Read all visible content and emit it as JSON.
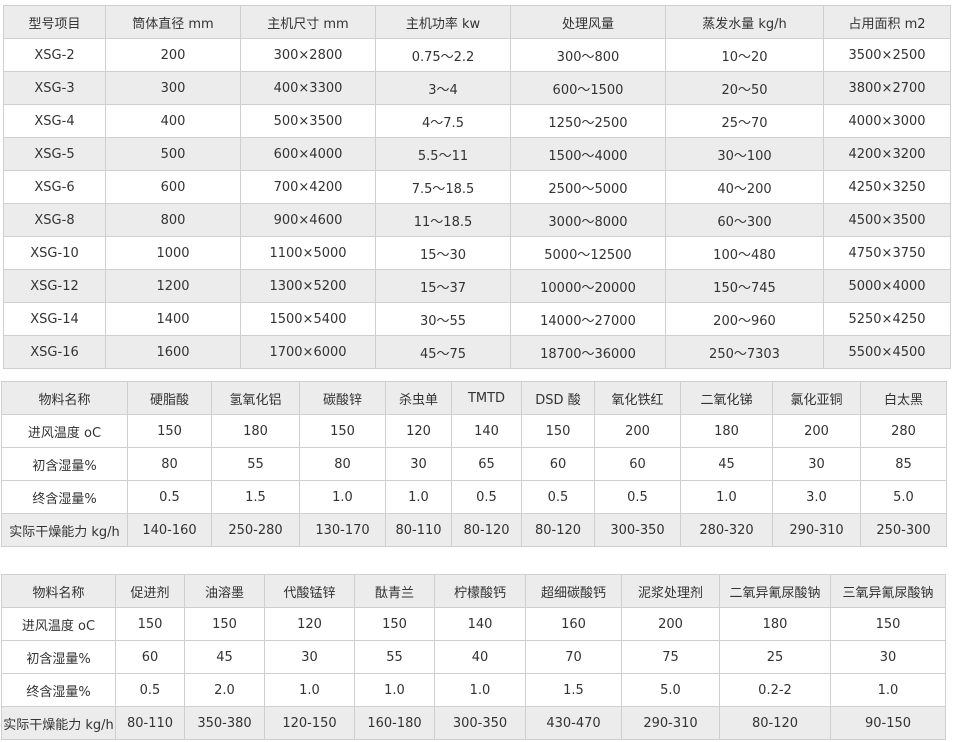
{
  "table1": {
    "header": [
      "型号项目",
      "筒体直径 mm",
      "主机尺寸 mm",
      "主机功率 kw",
      "处理风量",
      "蒸发水量 kg/h",
      "占用面积 m2"
    ],
    "rows": [
      [
        "XSG-2",
        "200",
        "300×2800",
        "0.75～2.2",
        "300～800",
        "10～20",
        "3500×2500"
      ],
      [
        "XSG-3",
        "300",
        "400×3300",
        "3～4",
        "600～1500",
        "20～50",
        "3800×2700"
      ],
      [
        "XSG-4",
        "400",
        "500×3500",
        "4～7.5",
        "1250～2500",
        "25～70",
        "4000×3000"
      ],
      [
        "XSG-5",
        "500",
        "600×4000",
        "5.5～11",
        "1500～4000",
        "30～100",
        "4200×3200"
      ],
      [
        "XSG-6",
        "600",
        "700×4200",
        "7.5～18.5",
        "2500～5000",
        "40～200",
        "4250×3250"
      ],
      [
        "XSG-8",
        "800",
        "900×4600",
        "11～18.5",
        "3000～8000",
        "60～300",
        "4500×3500"
      ],
      [
        "XSG-10",
        "1000",
        "1100×5000",
        "15～30",
        "5000～12500",
        "100～480",
        "4750×3750"
      ],
      [
        "XSG-12",
        "1200",
        "1300×5200",
        "15～37",
        "10000～20000",
        "150～745",
        "5000×4000"
      ],
      [
        "XSG-14",
        "1400",
        "1500×5400",
        "30～55",
        "14000～27000",
        "200～960",
        "5250×4250"
      ],
      [
        "XSG-16",
        "1600",
        "1700×6000",
        "45～75",
        "18700～36000",
        "250～7303",
        "5500×4500"
      ]
    ]
  },
  "table2": {
    "rows": [
      [
        "物料名称",
        "硬脂酸",
        "氢氧化铝",
        "碳酸锌",
        "杀虫单",
        "TMTD",
        "DSD 酸",
        "氧化铁红",
        "二氧化锑",
        "氯化亚铜",
        "白太黑"
      ],
      [
        "进风温度 oC",
        "150",
        "180",
        "150",
        "120",
        "140",
        "150",
        "200",
        "180",
        "200",
        "280"
      ],
      [
        "初含湿量%",
        "80",
        "55",
        "80",
        "30",
        "65",
        "60",
        "60",
        "45",
        "30",
        "85"
      ],
      [
        "终含湿量%",
        "0.5",
        "1.5",
        "1.0",
        "1.0",
        "0.5",
        "0.5",
        "0.5",
        "1.0",
        "3.0",
        "5.0"
      ],
      [
        "实际干燥能力 kg/h",
        "140-160",
        "250-280",
        "130-170",
        "80-110",
        "80-120",
        "80-120",
        "300-350",
        "280-320",
        "290-310",
        "250-300"
      ]
    ]
  },
  "table3": {
    "rows": [
      [
        "物料名称",
        "促进剂",
        "油溶墨",
        "代酸锰锌",
        "酞青兰",
        "柠檬酸钙",
        "超细碳酸钙",
        "泥浆处理剂",
        "二氧异氰尿酸钠",
        "三氧异氰尿酸钠"
      ],
      [
        "进风温度 oC",
        "150",
        "150",
        "120",
        "150",
        "140",
        "160",
        "200",
        "180",
        "150"
      ],
      [
        "初含湿量%",
        "60",
        "45",
        "30",
        "55",
        "40",
        "70",
        "75",
        "25",
        "30"
      ],
      [
        "终含湿量%",
        "0.5",
        "2.0",
        "1.0",
        "1.0",
        "1.0",
        "1.5",
        "5.0",
        "0.2-2",
        "1.0"
      ],
      [
        "实际干燥能力 kg/h",
        "80-110",
        "350-380",
        "120-150",
        "160-180",
        "300-350",
        "430-470",
        "290-310",
        "80-120",
        "90-150"
      ]
    ]
  }
}
